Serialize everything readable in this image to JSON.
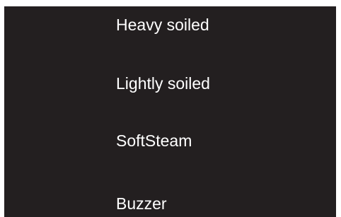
{
  "menu": {
    "items": [
      {
        "label": "Heavy soiled"
      },
      {
        "label": "Lightly soiled"
      },
      {
        "label": "SoftSteam"
      },
      {
        "label": "Buzzer"
      }
    ]
  },
  "colors": {
    "screen_background": "#231f20",
    "text": "#ffffff",
    "page_background": "#ffffff"
  }
}
